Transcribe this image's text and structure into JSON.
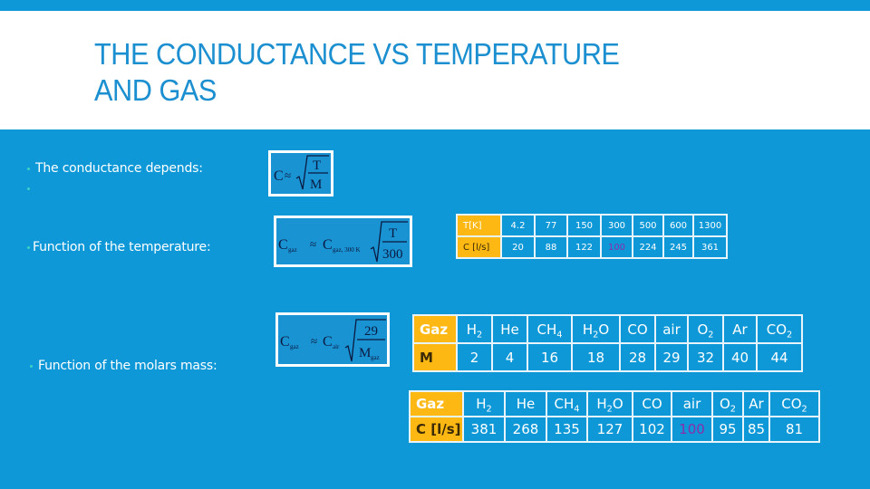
{
  "slide": {
    "title_line1": "THE CONDUCTANCE VS TEMPERATURE",
    "title_line2": "AND GAS",
    "colors": {
      "background": "#0e98d8",
      "title_band": "#ffffff",
      "title_text": "#1b8fd0",
      "header_cell": "#fdb813",
      "highlight_value": "#8a2fa8",
      "bullet": "#3cd3c4"
    }
  },
  "bullets": [
    {
      "text": "The conductance depends:"
    },
    {
      "text": ""
    },
    {
      "text": "Function of the temperature:"
    },
    {
      "text": "Function of the molars mass:"
    }
  ],
  "formulas": {
    "basic": "C ≈ √(T/M)",
    "temperature": "C_gaz ≈ C_gaz,300 K √(T/300)",
    "molar_mass": "C_gaz ≈ C_air √(29/M_gaz)",
    "labels": {
      "C": "C",
      "approx": "≈",
      "T": "T",
      "M": "M",
      "sub_gaz": "gaz",
      "sub_gaz300": "gaz, 300 K",
      "sub_air": "air",
      "n300": "300",
      "n29": "29"
    }
  },
  "temperature_table": {
    "row_headers": [
      "T[K]",
      "C [l/s]"
    ],
    "T": [
      "4.2",
      "77",
      "150",
      "300",
      "500",
      "600",
      "1300"
    ],
    "C": [
      "20",
      "88",
      "122",
      "100",
      "224",
      "245",
      "361"
    ],
    "highlight_index": 3
  },
  "molar_table": {
    "row_headers": [
      "Gaz",
      "M"
    ],
    "gases": [
      {
        "base": "H",
        "sub": "2",
        "tail": ""
      },
      {
        "base": "He",
        "sub": "",
        "tail": ""
      },
      {
        "base": "CH",
        "sub": "4",
        "tail": ""
      },
      {
        "base": "H",
        "sub": "2",
        "tail": "O"
      },
      {
        "base": "CO",
        "sub": "",
        "tail": ""
      },
      {
        "base": "air",
        "sub": "",
        "tail": ""
      },
      {
        "base": "O",
        "sub": "2",
        "tail": ""
      },
      {
        "base": "Ar",
        "sub": "",
        "tail": ""
      },
      {
        "base": "CO",
        "sub": "2",
        "tail": ""
      }
    ],
    "M": [
      "2",
      "4",
      "16",
      "18",
      "28",
      "29",
      "32",
      "40",
      "44"
    ]
  },
  "conductance_table": {
    "row_headers": [
      "Gaz",
      "C [l/s]"
    ],
    "gases": [
      {
        "base": "H",
        "sub": "2",
        "tail": ""
      },
      {
        "base": "He",
        "sub": "",
        "tail": ""
      },
      {
        "base": "CH",
        "sub": "4",
        "tail": ""
      },
      {
        "base": "H",
        "sub": "2",
        "tail": "O"
      },
      {
        "base": "CO",
        "sub": "",
        "tail": ""
      },
      {
        "base": "air",
        "sub": "",
        "tail": ""
      },
      {
        "base": "O",
        "sub": "2",
        "tail": ""
      },
      {
        "base": "Ar",
        "sub": "",
        "tail": ""
      },
      {
        "base": "CO",
        "sub": "2",
        "tail": ""
      }
    ],
    "C": [
      "381",
      "268",
      "135",
      "127",
      "102",
      "100",
      "95",
      "85",
      "81"
    ],
    "highlight_index": 5
  }
}
